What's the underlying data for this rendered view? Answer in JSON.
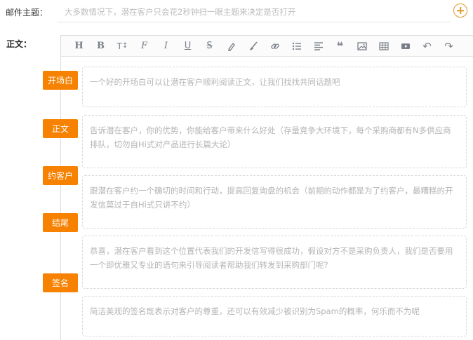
{
  "subject": {
    "label": "邮件主题：",
    "placeholder": "大多数情况下，潜在客户只会花2秒钟扫一眼主题来决定是否打开"
  },
  "body": {
    "label": "正文："
  },
  "toolbar": {
    "items": [
      {
        "name": "heading-icon",
        "glyph": "H"
      },
      {
        "name": "bold-icon",
        "glyph": "B"
      },
      {
        "name": "font-size-icon",
        "glyph": "T↕"
      },
      {
        "name": "font-family-icon",
        "glyph": "F"
      },
      {
        "name": "italic-icon",
        "glyph": "I"
      },
      {
        "name": "underline-icon",
        "glyph": "U"
      },
      {
        "name": "strikethrough-icon",
        "glyph": "S"
      },
      {
        "name": "highlight-pen-icon",
        "glyph": ""
      },
      {
        "name": "brush-icon",
        "glyph": ""
      },
      {
        "name": "link-icon",
        "glyph": ""
      },
      {
        "name": "bulleted-list-icon",
        "glyph": ""
      },
      {
        "name": "align-icon",
        "glyph": ""
      },
      {
        "name": "quote-icon",
        "glyph": "❝"
      },
      {
        "name": "image-icon",
        "glyph": ""
      },
      {
        "name": "table-icon",
        "glyph": ""
      },
      {
        "name": "video-icon",
        "glyph": ""
      },
      {
        "name": "undo-icon",
        "glyph": "↶"
      },
      {
        "name": "redo-icon",
        "glyph": "↷"
      }
    ]
  },
  "tags": {
    "opening": "开场白",
    "main": "正文",
    "appointment": "约客户",
    "ending": "结尾",
    "signature": "签名"
  },
  "blocks": {
    "opening": "一个好的开场白可以让潜在客户顺利阅读正文，让我们找找共同话题吧",
    "main": "告诉潜在客户，你的优势，你能给客户带来什么好处（存量竞争大环境下，每个采购商都有N多供应商排队，切勿自Hi式对产品进行长篇大论）",
    "appointment": "跟潜在客户约一个确切的时间和行动，提高回复询盘的机会（前期的动作都是为了约客户，最糟糕的开发信莫过于自Hi式只讲不约）",
    "ending": "恭喜，潜在客户看到这个位置代表我们的开发信写得很成功，假设对方不是采购负责人，我们是否要用一个即优雅又专业的语句来引导阅读者帮助我们转发到采购部门呢?",
    "signature": "简洁美观的签名既表示对客户的尊重，还可以有效减少被识别为Spam的概率，何乐而不为呢"
  },
  "colors": {
    "accent": "#f78100",
    "add_icon": "#e09a2a",
    "placeholder": "#b4b4b4",
    "dashed_border": "#d8d8d8"
  }
}
